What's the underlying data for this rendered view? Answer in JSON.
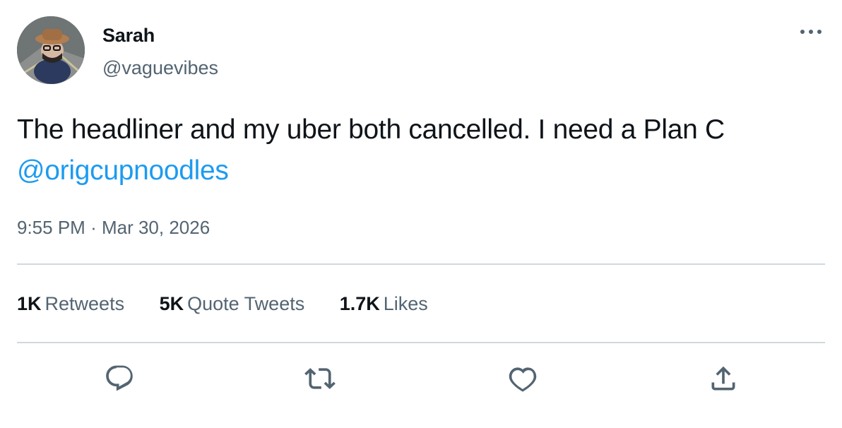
{
  "author": {
    "display_name": "Sarah",
    "handle": "@vaguevibes",
    "avatar_icon": "user-avatar-photo"
  },
  "tweet": {
    "text": "The headliner and my uber both cancelled. I need a Plan C",
    "mention": "@origcupnoodles"
  },
  "meta": {
    "time": "9:55 PM",
    "separator": "·",
    "date": "Mar 30, 2026"
  },
  "stats": [
    {
      "count": "1K",
      "label": "Retweets"
    },
    {
      "count": "5K",
      "label": "Quote Tweets"
    },
    {
      "count": "1.7K",
      "label": "Likes"
    }
  ],
  "actions": [
    {
      "icon": "reply-icon"
    },
    {
      "icon": "retweet-icon"
    },
    {
      "icon": "like-heart-icon"
    },
    {
      "icon": "share-icon"
    }
  ],
  "colors": {
    "text_primary": "#0f1419",
    "text_secondary": "#536471",
    "link": "#1d9bf0",
    "divider": "#cfd9de"
  }
}
